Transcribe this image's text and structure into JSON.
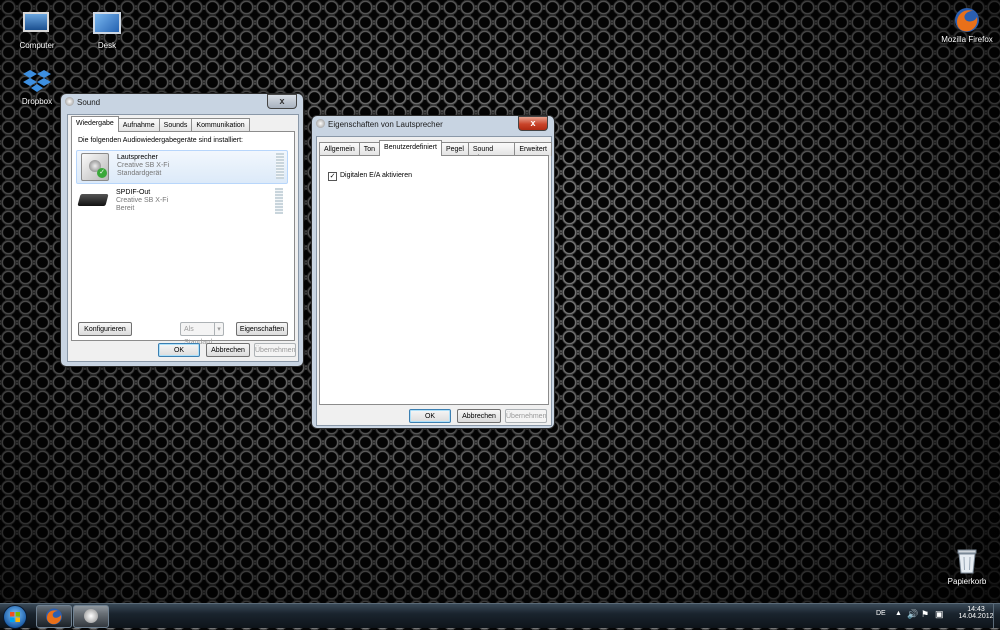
{
  "desktop": {
    "icons": [
      {
        "label": "Computer",
        "icon": "computer-icon"
      },
      {
        "label": "Desk",
        "icon": "monitor-icon"
      },
      {
        "label": "Dropbox",
        "icon": "dropbox-icon"
      },
      {
        "label": "Mozilla Firefox",
        "icon": "firefox-icon"
      },
      {
        "label": "Papierkorb",
        "icon": "recycle-bin-icon"
      }
    ]
  },
  "sound_window": {
    "title": "Sound",
    "close": "x",
    "tabs": [
      "Wiedergabe",
      "Aufnahme",
      "Sounds",
      "Kommunikation"
    ],
    "active_tab": "Wiedergabe",
    "intro": "Die folgenden Audiowiedergabegeräte sind installiert:",
    "devices": [
      {
        "name": "Lautsprecher",
        "driver": "Creative SB X-Fi",
        "status": "Standardgerät",
        "icon": "speaker-icon",
        "default_badge": "check-icon"
      },
      {
        "name": "SPDIF-Out",
        "driver": "Creative SB X-Fi",
        "status": "Bereit",
        "icon": "spdif-device-icon"
      }
    ],
    "buttons": {
      "configure": "Konfigurieren",
      "set_default": "Als Standard",
      "properties": "Eigenschaften",
      "ok": "OK",
      "cancel": "Abbrechen",
      "apply": "Übernehmen"
    }
  },
  "props_window": {
    "title": "Eigenschaften von Lautsprecher",
    "close": "x",
    "tabs": [
      "Allgemein",
      "Ton",
      "Benutzerdefiniert",
      "Pegel",
      "Sound Blaster",
      "Erweitert"
    ],
    "active_tab": "Benutzerdefiniert",
    "checkbox_label": "Digitalen E/A aktivieren",
    "checkbox_checked": true,
    "buttons": {
      "ok": "OK",
      "cancel": "Abbrechen",
      "apply": "Übernehmen"
    }
  },
  "taskbar": {
    "language": "DE",
    "time": "14:43",
    "date": "14.04.2012",
    "tray_icons": [
      "arrow-up-icon",
      "volume-icon",
      "flag-icon",
      "network-icon"
    ],
    "pinned": [
      "firefox-icon",
      "speaker-icon"
    ]
  },
  "colors": {
    "close_red": "#c9442a",
    "default_button_border": "#3c7fb1"
  }
}
